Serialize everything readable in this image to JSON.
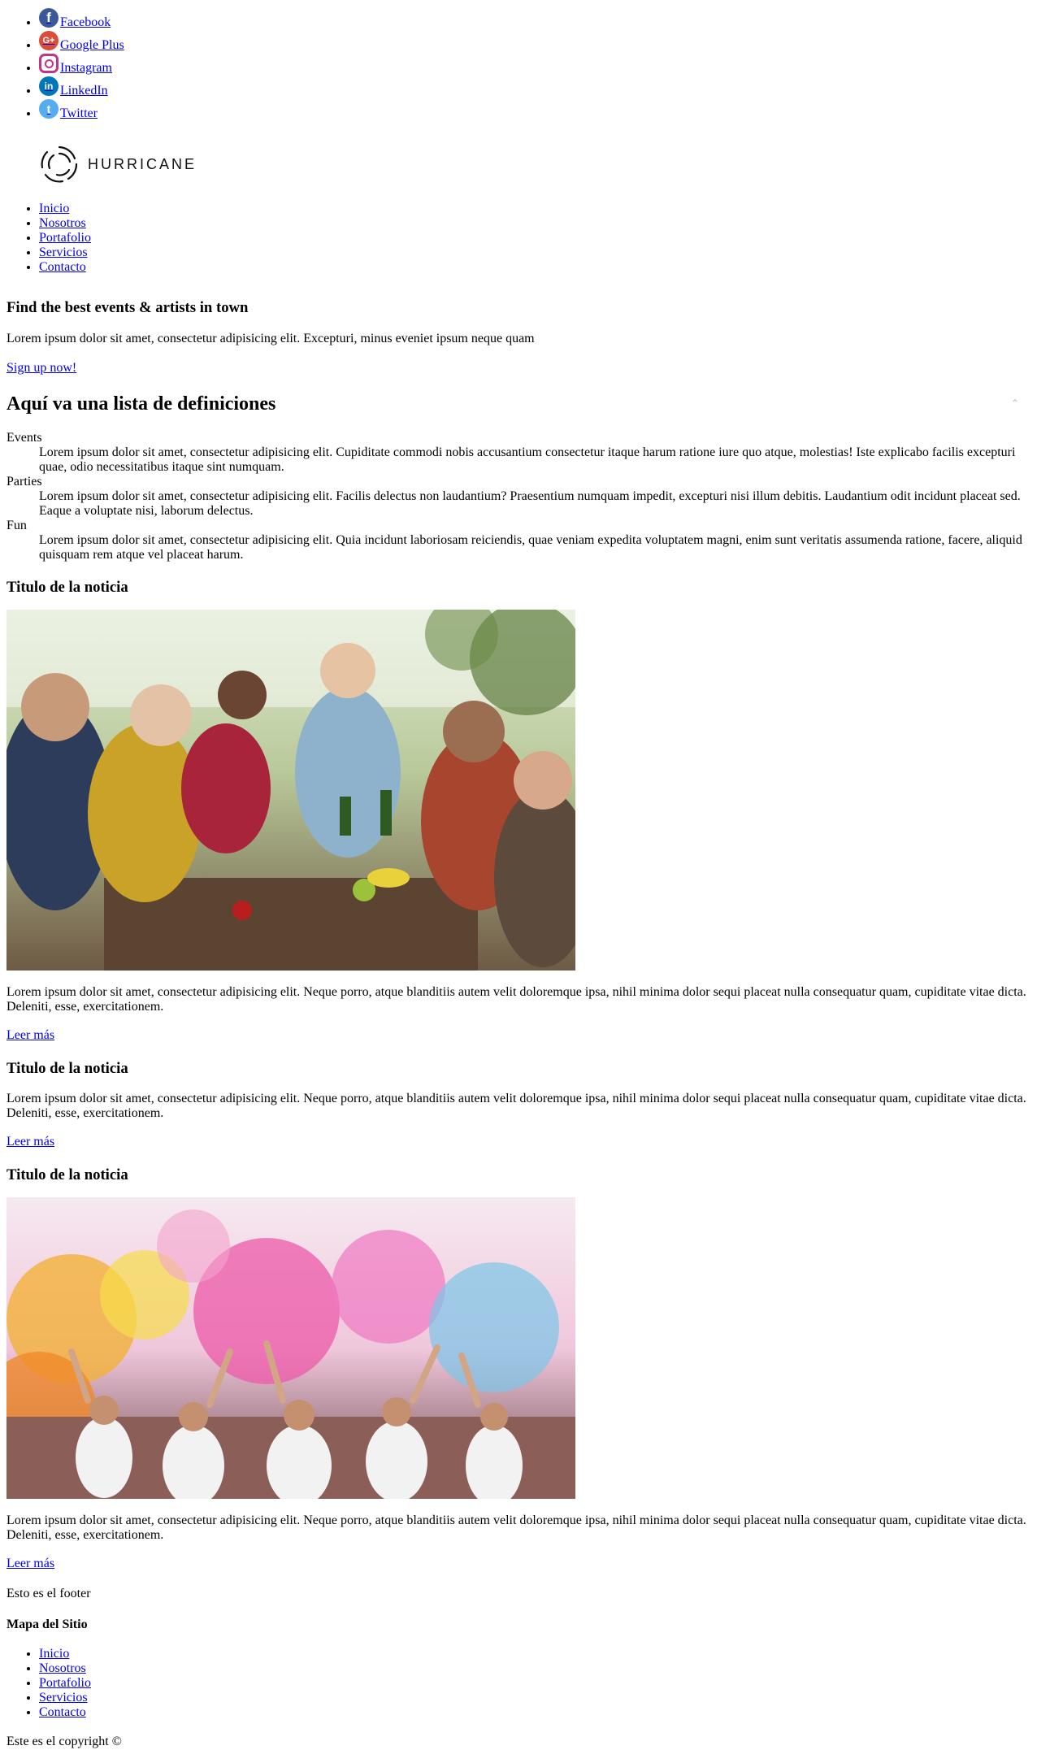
{
  "social": [
    {
      "label": "Facebook",
      "icon": "facebook-icon",
      "glyph": "f"
    },
    {
      "label": "Google Plus",
      "icon": "google-plus-icon",
      "glyph": "G+"
    },
    {
      "label": "Instagram",
      "icon": "instagram-icon",
      "glyph": ""
    },
    {
      "label": "LinkedIn",
      "icon": "linkedin-icon",
      "glyph": "in"
    },
    {
      "label": "Twitter",
      "icon": "twitter-icon",
      "glyph": "t"
    }
  ],
  "logo": {
    "text": "HURRICANE"
  },
  "nav": [
    "Inicio",
    "Nosotros",
    "Portafolio",
    "Servicios",
    "Contacto"
  ],
  "hero": {
    "title": "Find the best events & artists in town",
    "text": "Lorem ipsum dolor sit amet, consectetur adipisicing elit. Excepturi, minus eveniet ipsum neque quam",
    "cta": "Sign up now!"
  },
  "definitions": {
    "title": "Aquí va una lista de definiciones",
    "items": [
      {
        "term": "Events",
        "desc": "Lorem ipsum dolor sit amet, consectetur adipisicing elit. Cupiditate commodi nobis accusantium consectetur itaque harum ratione iure quo atque, molestias! Iste explicabo facilis excepturi quae, odio necessitatibus itaque sint numquam."
      },
      {
        "term": "Parties",
        "desc": "Lorem ipsum dolor sit amet, consectetur adipisicing elit. Facilis delectus non laudantium? Praesentium numquam impedit, excepturi nisi illum debitis. Laudantium odit incidunt placeat sed. Eaque a voluptate nisi, laborum delectus."
      },
      {
        "term": "Fun",
        "desc": "Lorem ipsum dolor sit amet, consectetur adipisicing elit. Quia incidunt laboriosam reiciendis, quae veniam expedita voluptatem magni, enim sunt veritatis assumenda ratione, facere, aliquid quisquam rem atque vel placeat harum."
      }
    ]
  },
  "news": [
    {
      "title": "Titulo de la noticia",
      "text": "Lorem ipsum dolor sit amet, consectetur adipisicing elit. Neque porro, atque blanditiis autem velit doloremque ipsa, nihil minima dolor sequi placeat nulla consequatur quam, cupiditate vitae dicta. Deleniti, esse, exercitationem.",
      "link": "Leer más"
    },
    {
      "title": "Titulo de la noticia",
      "text": "Lorem ipsum dolor sit amet, consectetur adipisicing elit. Neque porro, atque blanditiis autem velit doloremque ipsa, nihil minima dolor sequi placeat nulla consequatur quam, cupiditate vitae dicta. Deleniti, esse, exercitationem.",
      "link": "Leer más"
    },
    {
      "title": "Titulo de la noticia",
      "text": "Lorem ipsum dolor sit amet, consectetur adipisicing elit. Neque porro, atque blanditiis autem velit doloremque ipsa, nihil minima dolor sequi placeat nulla consequatur quam, cupiditate vitae dicta. Deleniti, esse, exercitationem.",
      "link": "Leer más"
    }
  ],
  "footer": {
    "text": "Esto es el footer",
    "sitemap_title": "Mapa del Sitio",
    "nav": [
      "Inicio",
      "Nosotros",
      "Portafolio",
      "Servicios",
      "Contacto"
    ],
    "copyright": "Este es el copyright ©"
  },
  "colors": {
    "link": "#0000ee",
    "facebook": "#3b5998",
    "google_plus": "#dd4b39",
    "instagram": "#c13584",
    "linkedin": "#0077b5",
    "twitter": "#55acee"
  }
}
